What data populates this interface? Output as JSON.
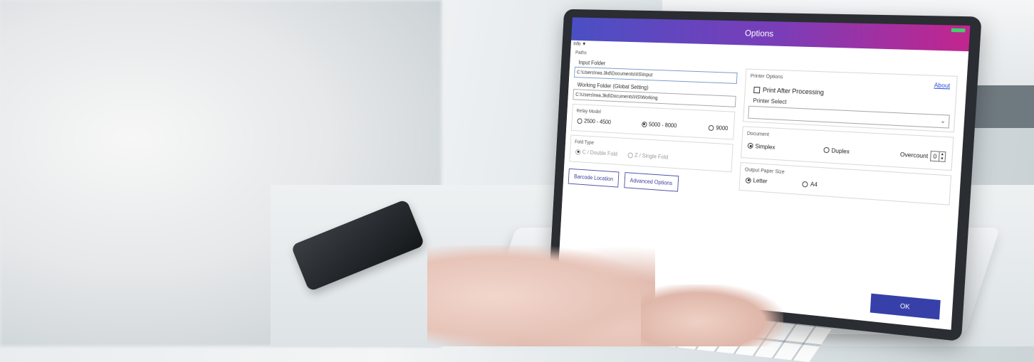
{
  "window": {
    "title": "Options",
    "menu_label": "Info ▼"
  },
  "paths": {
    "group_label": "Paths",
    "input_folder_label": "Input Folder",
    "input_folder_value": "C:\\Users\\rwa.3kd\\Documents\\IIS\\Input",
    "working_folder_label": "Working Folder (Global Setting)",
    "working_folder_value": "C:\\Users\\rwa.3kd\\Documents\\IIS\\Working"
  },
  "relay_model": {
    "label": "Relay Model",
    "options": [
      "2500 - 4500",
      "5000 - 8000",
      "9000"
    ],
    "selected": "5000 - 8000"
  },
  "fold_type": {
    "label": "Fold Type",
    "options": [
      "C / Double Fold",
      "Z / Single Fold"
    ],
    "selected": "C / Double Fold",
    "enabled": false
  },
  "buttons": {
    "barcode_location": "Barcode Location",
    "advanced_options": "Advanced Options",
    "ok": "OK"
  },
  "printer_options": {
    "label": "Printer Options",
    "about_link": "About",
    "print_after_processing": "Print After Processing",
    "print_after_processing_checked": false,
    "printer_select_label": "Printer Select",
    "printer_select_value": ""
  },
  "document": {
    "label": "Document",
    "options": [
      "Simplex",
      "Duplex"
    ],
    "selected": "Simplex",
    "overcount_label": "Overcount",
    "overcount_value": "0"
  },
  "output_paper_size": {
    "label": "Output Paper Size",
    "options": [
      "Letter",
      "A4"
    ],
    "selected": "Letter"
  },
  "colors": {
    "title_gradient_start": "#4b4fc4",
    "title_gradient_end": "#c2258e",
    "ok_button": "#3740a8",
    "about_link": "#2a4fd6"
  }
}
